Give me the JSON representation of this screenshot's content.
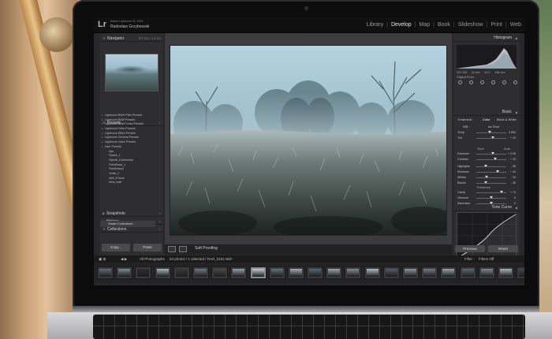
{
  "app": {
    "logo": "Lr",
    "version": "Adobe Lightroom CC 2015",
    "user": "Radosław Grzybowski"
  },
  "modules": [
    "Library",
    "Develop",
    "Map",
    "Book",
    "Slideshow",
    "Print",
    "Web"
  ],
  "active_module": "Develop",
  "left_panel": {
    "navigator": {
      "title": "Navigator",
      "zoom": "FIT  FILL  1:1  3:1"
    },
    "presets": {
      "title": "Presets",
      "items": [
        {
          "label": "Lightroom B&W Filter Presets",
          "sub": false
        },
        {
          "label": "Lightroom B&W Presets",
          "sub": false
        },
        {
          "label": "Lightroom B&W Toned Presets",
          "sub": false
        },
        {
          "label": "Lightroom Color Presets",
          "sub": false
        },
        {
          "label": "Lightroom Effect Presets",
          "sub": false
        },
        {
          "label": "Lightroom General Presets",
          "sub": false
        },
        {
          "label": "Lightroom Video Presets",
          "sub": false
        },
        {
          "label": "User Presets",
          "sub": false
        },
        {
          "label": "bjur",
          "sub": true
        },
        {
          "label": "Radek_1",
          "sub": true
        },
        {
          "label": "Rybnik_Dobromnia",
          "sub": true
        },
        {
          "label": "RafuMowy_1",
          "sub": true
        },
        {
          "label": "RafuMowy2",
          "sub": true
        },
        {
          "label": "Smile_2",
          "sub": true
        },
        {
          "label": "skin_iPhone",
          "sub": true
        },
        {
          "label": "tetra_matl",
          "sub": true
        }
      ]
    },
    "snapshots": "Snapshots",
    "history": "History",
    "collections": "Collections",
    "smart_collections": "Smart Collections",
    "copy_button": "Copy...",
    "paste_button": "Paste"
  },
  "toolbar": {
    "soft_proofing": "Soft Proofing"
  },
  "right_panel": {
    "histogram_title": "Histogram",
    "readout": [
      "ISO 100",
      "24 mm",
      "f/4.0",
      "1/80 sec"
    ],
    "original_photo": "Original Photo",
    "basic_title": "Basic",
    "treatment": {
      "label": "Treatment :",
      "color": "Color",
      "bw": "Black & White"
    },
    "wb": {
      "label": "WB :",
      "value": "As Shot"
    },
    "temp_tint": [
      {
        "label": "Temp",
        "value": "4 850",
        "pos": 0.45
      },
      {
        "label": "Tint",
        "value": "+ 10",
        "pos": 0.55
      }
    ],
    "tone": {
      "label": "Tone",
      "auto": "Auto"
    },
    "tone_sliders": [
      {
        "label": "Exposure",
        "value": "+ 0,35",
        "pos": 0.55
      },
      {
        "label": "Contrast",
        "value": "+ 33",
        "pos": 0.62
      }
    ],
    "tone_sliders2": [
      {
        "label": "Highlights",
        "value": "- 36",
        "pos": 0.32
      },
      {
        "label": "Shadows",
        "value": "+ 44",
        "pos": 0.7
      },
      {
        "label": "Whites",
        "value": "- 34",
        "pos": 0.33
      },
      {
        "label": "Blacks",
        "value": "- 38",
        "pos": 0.32
      }
    ],
    "presence": "Presence",
    "presence_sliders": [
      {
        "label": "Clarity",
        "value": "+ 74",
        "pos": 0.85
      },
      {
        "label": "Vibrance",
        "value": "0",
        "pos": 0.5
      },
      {
        "label": "Saturation",
        "value": "0",
        "pos": 0.5
      }
    ],
    "tone_curve_title": "Tone Curve",
    "previous_button": "Previous",
    "reset_button": "Reset"
  },
  "filmstrip": {
    "source": "All Photographs",
    "info": "84 photos / 1 selected / RAD_0151.NEF",
    "filter_label": "Filter :",
    "filter_value": "Filters Off",
    "thumbnails": 23,
    "selected_index": 8
  }
}
